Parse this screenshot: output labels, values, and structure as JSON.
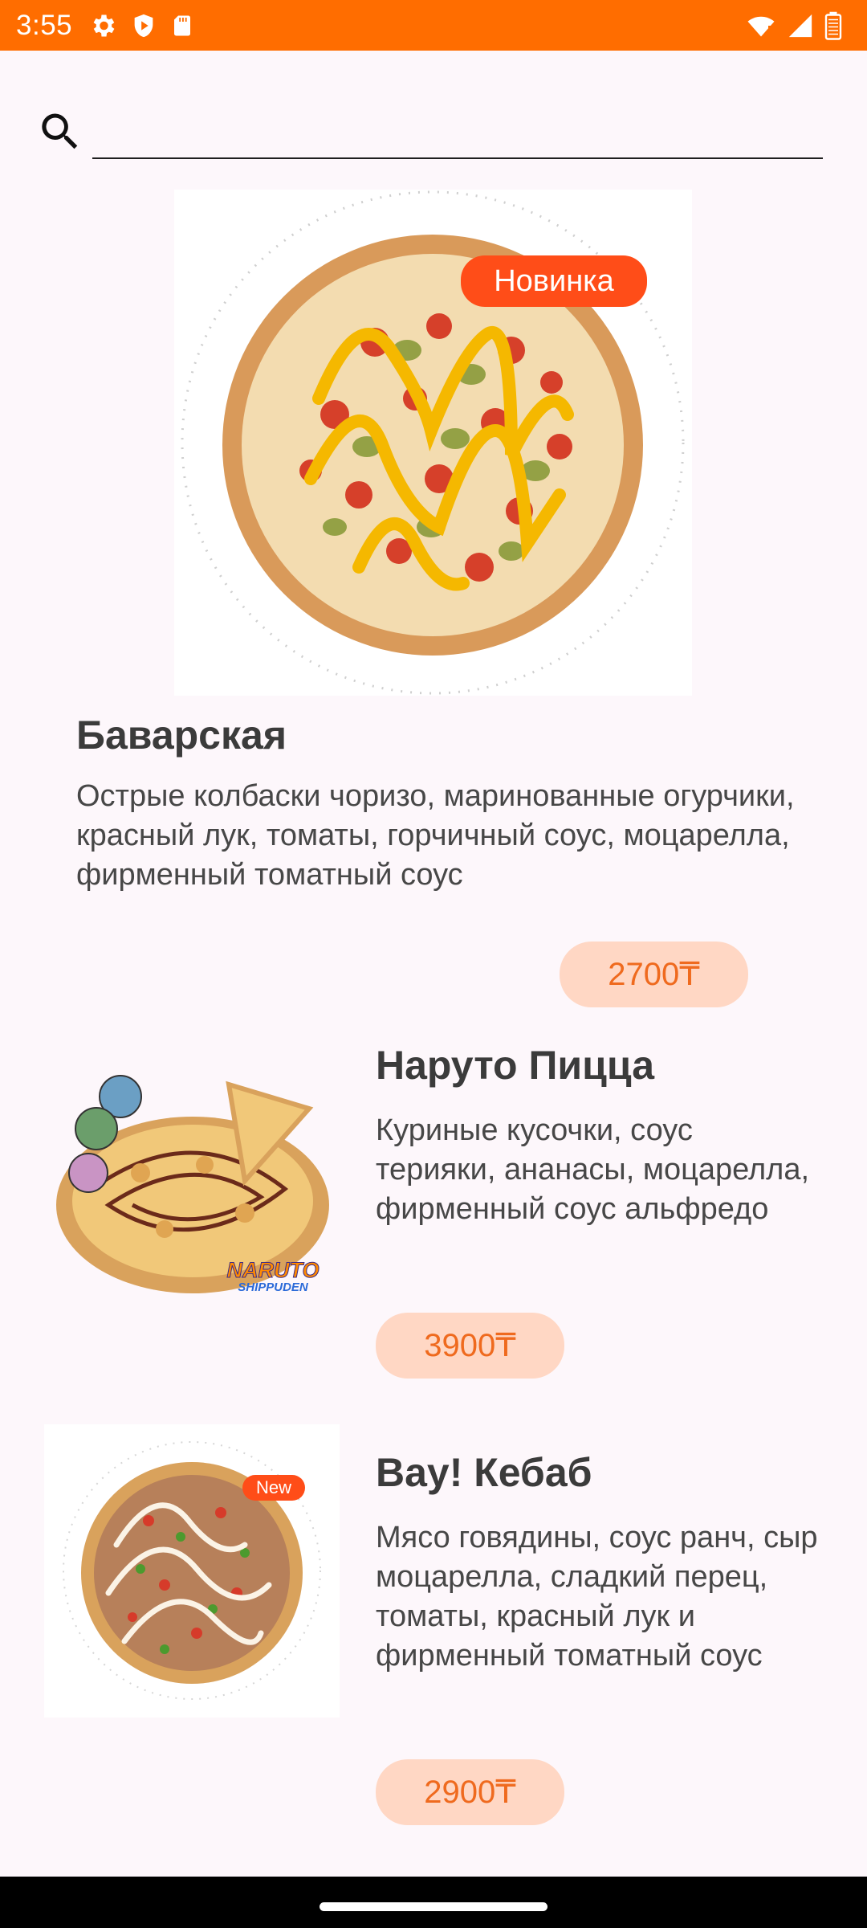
{
  "status_bar": {
    "time": "3:55",
    "left_icons": [
      "settings-icon",
      "play-protect-icon",
      "sd-card-icon"
    ],
    "right_icons": [
      "wifi-icon",
      "signal-icon",
      "battery-icon"
    ]
  },
  "search": {
    "placeholder": "",
    "value": ""
  },
  "products": [
    {
      "name": "Баварская",
      "description": "Острые колбаски чоризо, маринованные огурчики, красный лук, томаты, горчичный соус, моцарелла, фирменный томатный соус",
      "price": "2700₸",
      "badge": "Новинка"
    },
    {
      "name": "Наруто Пицца",
      "description": "Куриные кусочки, соус терияки, ананасы, моцарелла, фирменный соус альфредо",
      "price": "3900₸",
      "logo_text": "NARUTO",
      "logo_subtext": "SHIPPUDEN"
    },
    {
      "name": "Вау! Кебаб",
      "description": "Мясо говядины, соус ранч, сыр моцарелла, сладкий перец, томаты, красный лук и фирменный томатный соус",
      "price": "2900₸",
      "badge": "New"
    }
  ],
  "colors": {
    "accent": "#ff6d00",
    "price_bg": "#ffd7c4",
    "price_text": "#ef6a1e",
    "background": "#fdf7fb"
  }
}
